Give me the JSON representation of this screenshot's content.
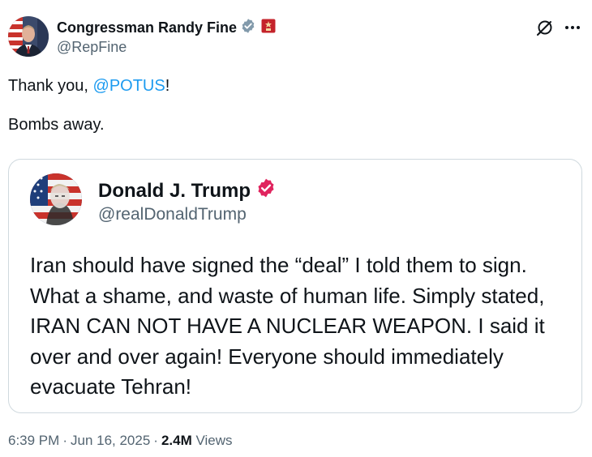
{
  "author": {
    "name": "Congressman Randy Fine",
    "handle": "@RepFine"
  },
  "tweet": {
    "text_prefix": "Thank you, ",
    "mention": "@POTUS",
    "text_suffix": "!\n\nBombs away."
  },
  "quote": {
    "name": "Donald J. Trump",
    "handle": "@realDonaldTrump",
    "text": "Iran should have signed the “deal” I told them to sign. What a shame, and waste of human life. Simply stated, IRAN CAN NOT HAVE A NUCLEAR WEAPON. I said it over and over again! Everyone should immediately evacuate Tehran!"
  },
  "meta": {
    "time": "6:39 PM",
    "date": "Jun 16, 2025",
    "separator": "·",
    "views_count": "2.4M",
    "views_label": "Views"
  },
  "icons": {
    "verified_gov": "verified-gray-icon",
    "verified_org": "verified-pink-icon",
    "affiliation": "house-seal-icon",
    "grok": "grok-icon",
    "more": "more-icon"
  },
  "colors": {
    "link": "#1d9bf0",
    "text": "#0f1419",
    "secondary": "#536471",
    "border": "#cfd9de",
    "gov_badge": "#829aab",
    "org_badge": "#e0245e"
  }
}
